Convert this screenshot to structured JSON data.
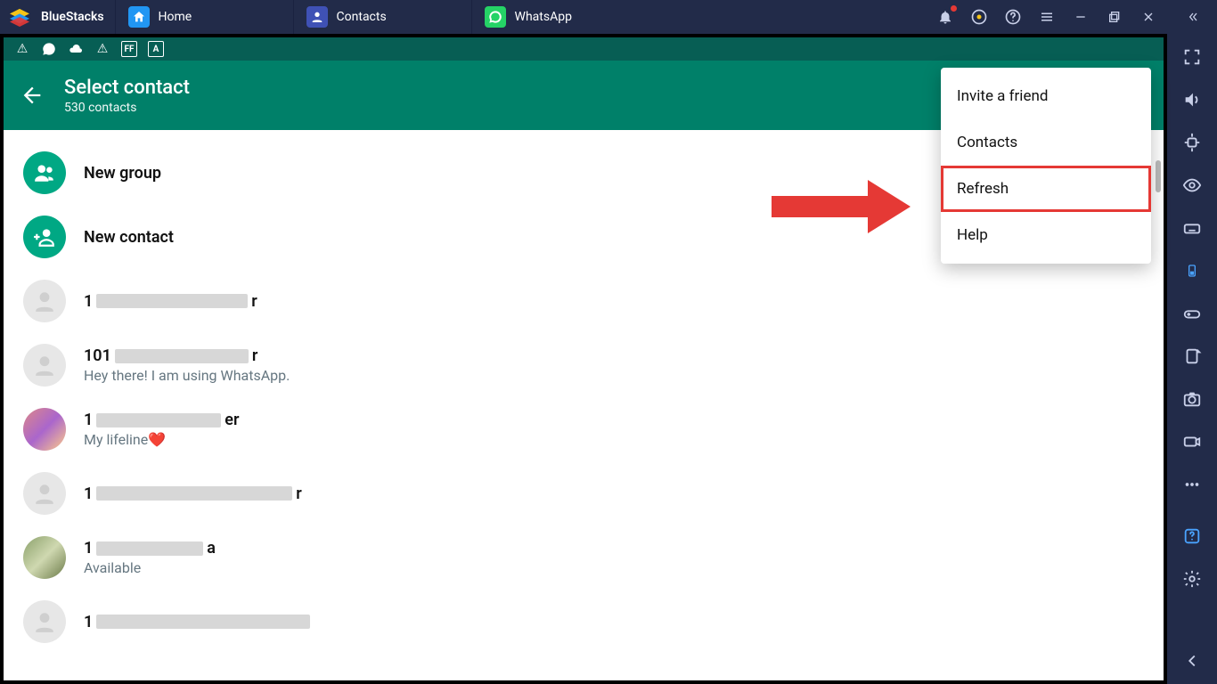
{
  "emulator": {
    "name": "BlueStacks",
    "tabs": [
      {
        "label": "Home"
      },
      {
        "label": "Contacts"
      },
      {
        "label": "WhatsApp"
      }
    ]
  },
  "whatsapp": {
    "header": {
      "title": "Select contact",
      "subtitle": "530 contacts"
    },
    "actions": {
      "new_group": "New group",
      "new_contact": "New contact"
    },
    "menu": {
      "invite": "Invite a friend",
      "contacts": "Contacts",
      "refresh": "Refresh",
      "help": "Help"
    },
    "list": [
      {
        "prefix": "1",
        "suffix": "r",
        "status": ""
      },
      {
        "prefix": "101",
        "suffix": "r",
        "status": "Hey there! I am using WhatsApp."
      },
      {
        "prefix": "1",
        "suffix": "er",
        "status": "My lifeline❤️"
      },
      {
        "prefix": "1",
        "suffix": "r",
        "status": ""
      },
      {
        "prefix": "1",
        "suffix": "a",
        "status": "Available"
      },
      {
        "prefix": "1",
        "suffix": "",
        "status": ""
      }
    ]
  }
}
